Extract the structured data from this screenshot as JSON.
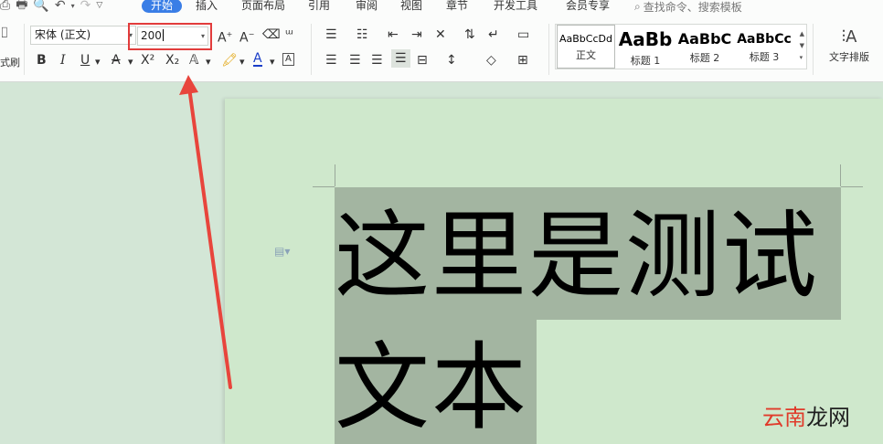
{
  "tabs": [
    "开始",
    "插入",
    "页面布局",
    "引用",
    "审阅",
    "视图",
    "章节",
    "开发工具",
    "会员专享"
  ],
  "search_placeholder": "查找命令、搜索模板",
  "left_cut_label": "式刷",
  "font": {
    "name": "宋体 (正文)",
    "size": "200"
  },
  "format_buttons": {
    "bold": "B",
    "italic": "I",
    "underline": "U",
    "superscript": "X²",
    "subscript": "X₂"
  },
  "styles": [
    {
      "sample": "AaBbCcDd",
      "label": "正文"
    },
    {
      "sample": "AaBb",
      "label": "标题 1"
    },
    {
      "sample": "AaBbC",
      "label": "标题 2"
    },
    {
      "sample": "AaBbCc",
      "label": "标题 3"
    }
  ],
  "text_layout_label": "文字排版",
  "document": {
    "line1": "这里是测试",
    "line2": "文本"
  },
  "watermark": {
    "part1": "云南",
    "part2": "龙网"
  },
  "colors": {
    "accent": "#3a7ee6",
    "highlight_box": "#e23c3c",
    "arrow": "#e8453c",
    "selection": "#a3b5a1",
    "page": "#cfe8cc"
  }
}
